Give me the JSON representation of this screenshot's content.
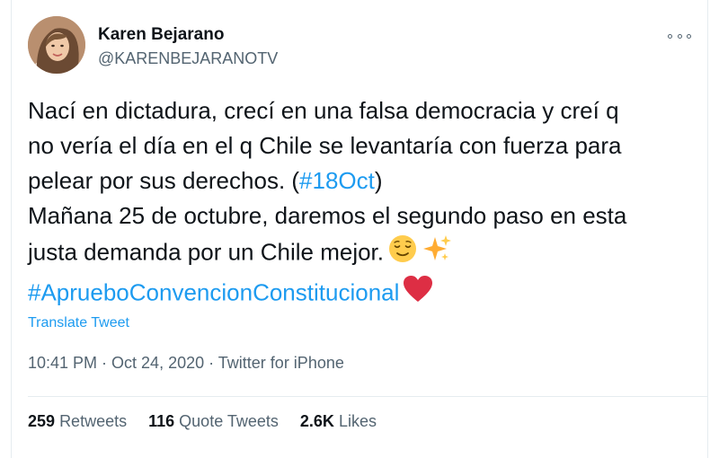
{
  "author": {
    "name": "Karen Bejarano",
    "handle": "@KARENBEJARANOTV"
  },
  "tweet": {
    "line1": "Nací en dictadura, crecí en una falsa democracia y creí q",
    "line2": "no vería el día en el q Chile se levantaría con fuerza para",
    "line3_text": "pelear por sus derechos. (",
    "line3_hashtag": "#18Oct",
    "line3_close": ")",
    "line4": "Mañana 25 de octubre, daremos el segundo paso en esta",
    "line5": "justa demanda por un Chile mejor.",
    "line6_hashtag": "#AprueboConvencionConstitucional",
    "emojis": [
      "relieved-face",
      "sparkles",
      "red-heart"
    ]
  },
  "translate_label": "Translate Tweet",
  "meta": {
    "time": "10:41 PM",
    "separator": " · ",
    "date": "Oct 24, 2020",
    "source": "Twitter for iPhone"
  },
  "stats": {
    "retweets_count": "259",
    "retweets_label": "Retweets",
    "quotes_count": "116",
    "quotes_label": "Quote Tweets",
    "likes_count": "2.6K",
    "likes_label": "Likes"
  },
  "colors": {
    "link": "#1d9bf0",
    "secondary": "#536471",
    "primary": "#0f1419",
    "border": "#e6ecf0"
  }
}
